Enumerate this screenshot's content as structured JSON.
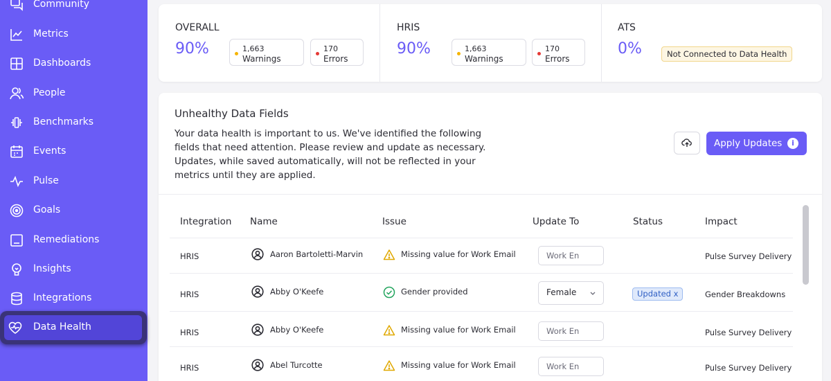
{
  "sidebar": {
    "items": [
      {
        "label": "Community",
        "icon": "chat-icon"
      },
      {
        "label": "Metrics",
        "icon": "line-chart-icon"
      },
      {
        "label": "Dashboards",
        "icon": "grid-icon"
      },
      {
        "label": "People",
        "icon": "people-icon"
      },
      {
        "label": "Benchmarks",
        "icon": "benchmark-icon"
      },
      {
        "label": "Events",
        "icon": "calendar-icon"
      },
      {
        "label": "Pulse",
        "icon": "pulse-icon"
      },
      {
        "label": "Goals",
        "icon": "target-icon"
      },
      {
        "label": "Remediations",
        "icon": "clipboard-icon"
      },
      {
        "label": "Insights",
        "icon": "lightbulb-icon"
      },
      {
        "label": "Integrations",
        "icon": "database-icon"
      },
      {
        "label": "Data Health",
        "icon": "heart-pulse-icon",
        "active": true
      }
    ]
  },
  "summary": {
    "overall": {
      "title": "OVERALL",
      "percent": "90%",
      "warnings_count": "1,663",
      "warnings_label": "Warnings",
      "errors_count": "170",
      "errors_label": "Errors"
    },
    "hris": {
      "title": "HRIS",
      "percent": "90%",
      "warnings_count": "1,663",
      "warnings_label": "Warnings",
      "errors_count": "170",
      "errors_label": "Errors"
    },
    "ats": {
      "title": "ATS",
      "percent": "0%",
      "badge": "Not Connected to Data Health"
    }
  },
  "main": {
    "title": "Unhealthy Data Fields",
    "description": "Your data health is important to us. We've identified the following fields that need attention. Please review and update as necessary. Updates, while saved automatically, will not be reflected in your metrics until they are applied.",
    "apply_label": "Apply Updates",
    "apply_info": "i"
  },
  "table": {
    "headers": [
      "Integration",
      "Name",
      "Issue",
      "Update To",
      "Status",
      "Impact"
    ],
    "rows": [
      {
        "integration": "HRIS",
        "name": "Aaron Bartoletti-Marvin",
        "issue": "Missing value for Work Email",
        "issue_type": "warning",
        "update_placeholder": "Work En",
        "status": "",
        "impact": "Pulse Survey Delivery"
      },
      {
        "integration": "HRIS",
        "name": "Abby O'Keefe",
        "issue": "Gender provided",
        "issue_type": "ok",
        "update_value": "Female",
        "status": "Updated x",
        "impact": "Gender Breakdowns"
      },
      {
        "integration": "HRIS",
        "name": "Abby O'Keefe",
        "issue": "Missing value for Work Email",
        "issue_type": "warning",
        "update_placeholder": "Work En",
        "status": "",
        "impact": "Pulse Survey Delivery"
      },
      {
        "integration": "HRIS",
        "name": "Abel Turcotte",
        "issue": "Missing value for Work Email",
        "issue_type": "warning",
        "update_placeholder": "Work En",
        "status": "",
        "impact": "Pulse Survey Delivery"
      }
    ]
  },
  "colors": {
    "accent": "#6a5cf6",
    "warning_dot": "#f5b400",
    "error_dot": "#e53935",
    "ok": "#22a45d"
  }
}
